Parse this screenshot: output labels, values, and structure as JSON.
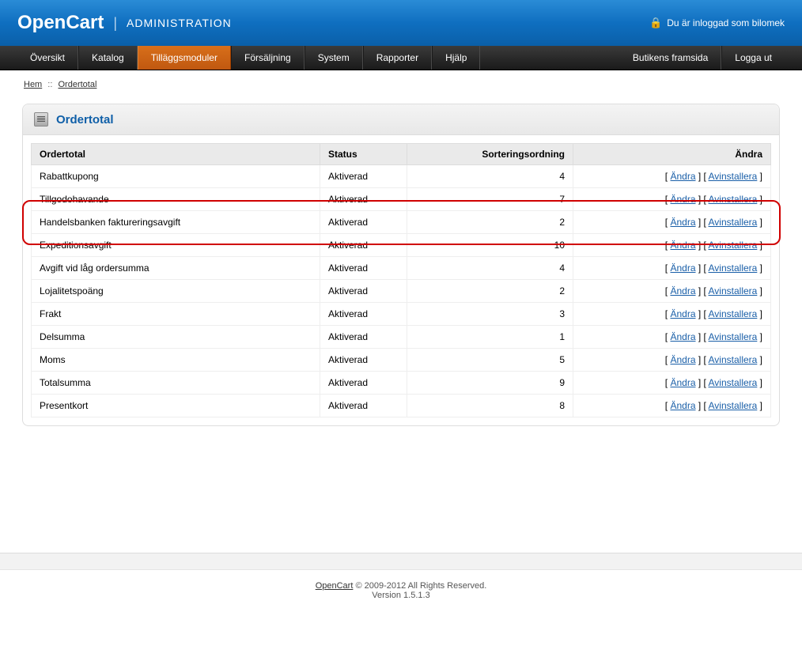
{
  "header": {
    "brand": "OpenCart",
    "sub": "ADMINISTRATION",
    "login_text": "Du är inloggad som bilomek"
  },
  "nav": {
    "items": [
      {
        "label": "Översikt",
        "active": false
      },
      {
        "label": "Katalog",
        "active": false
      },
      {
        "label": "Tilläggsmoduler",
        "active": true
      },
      {
        "label": "Försäljning",
        "active": false
      },
      {
        "label": "System",
        "active": false
      },
      {
        "label": "Rapporter",
        "active": false
      },
      {
        "label": "Hjälp",
        "active": false
      }
    ],
    "right": [
      {
        "label": "Butikens framsida"
      },
      {
        "label": "Logga ut"
      }
    ]
  },
  "crumbs": {
    "home": "Hem",
    "current": "Ordertotal"
  },
  "panel": {
    "title": "Ordertotal"
  },
  "table": {
    "columns": {
      "name": "Ordertotal",
      "status": "Status",
      "sort": "Sorteringsordning",
      "action": "Ändra"
    },
    "action_edit": "Ändra",
    "action_uninstall": "Avinstallera",
    "rows": [
      {
        "name": "Rabattkupong",
        "status": "Aktiverad",
        "sort": "4"
      },
      {
        "name": "Tillgodohavande",
        "status": "Aktiverad",
        "sort": "7"
      },
      {
        "name": "Handelsbanken faktureringsavgift",
        "status": "Aktiverad",
        "sort": "2",
        "highlight": true
      },
      {
        "name": "Expeditionsavgift",
        "status": "Aktiverad",
        "sort": "10"
      },
      {
        "name": "Avgift vid låg ordersumma",
        "status": "Aktiverad",
        "sort": "4"
      },
      {
        "name": "Lojalitetspoäng",
        "status": "Aktiverad",
        "sort": "2"
      },
      {
        "name": "Frakt",
        "status": "Aktiverad",
        "sort": "3"
      },
      {
        "name": "Delsumma",
        "status": "Aktiverad",
        "sort": "1"
      },
      {
        "name": "Moms",
        "status": "Aktiverad",
        "sort": "5"
      },
      {
        "name": "Totalsumma",
        "status": "Aktiverad",
        "sort": "9"
      },
      {
        "name": "Presentkort",
        "status": "Aktiverad",
        "sort": "8"
      }
    ]
  },
  "footer": {
    "link": "OpenCart",
    "text": " © 2009-2012 All Rights Reserved.",
    "version": "Version 1.5.1.3"
  }
}
